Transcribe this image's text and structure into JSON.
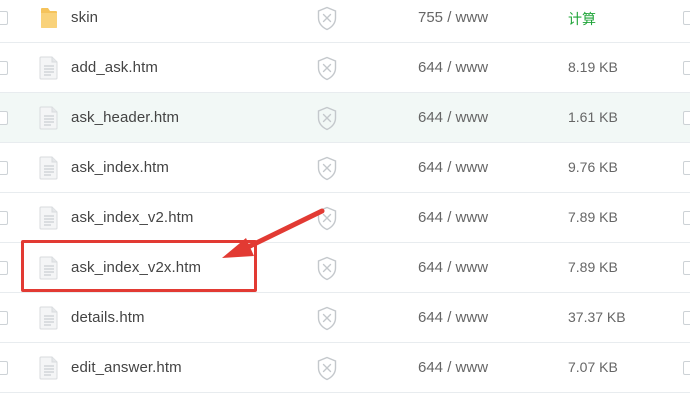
{
  "files": [
    {
      "name": "skin",
      "type": "folder",
      "perm": "755 / www",
      "size": "计算",
      "size_is_link": true
    },
    {
      "name": "add_ask.htm",
      "type": "file",
      "perm": "644 / www",
      "size": "8.19 KB",
      "size_is_link": false
    },
    {
      "name": "ask_header.htm",
      "type": "file",
      "perm": "644 / www",
      "size": "1.61 KB",
      "size_is_link": false
    },
    {
      "name": "ask_index.htm",
      "type": "file",
      "perm": "644 / www",
      "size": "9.76 KB",
      "size_is_link": false
    },
    {
      "name": "ask_index_v2.htm",
      "type": "file",
      "perm": "644 / www",
      "size": "7.89 KB",
      "size_is_link": false
    },
    {
      "name": "ask_index_v2x.htm",
      "type": "file",
      "perm": "644 / www",
      "size": "7.89 KB",
      "size_is_link": false
    },
    {
      "name": "details.htm",
      "type": "file",
      "perm": "644 / www",
      "size": "37.37 KB",
      "size_is_link": false
    },
    {
      "name": "edit_answer.htm",
      "type": "file",
      "perm": "644 / www",
      "size": "7.07 KB",
      "size_is_link": false
    }
  ],
  "hovered_row": 2,
  "highlighted_row": 5,
  "colors": {
    "accent_green": "#20a53a",
    "annotation_red": "#e23a33",
    "row_border": "#e8ecef",
    "hover_bg": "#f2f8f6"
  },
  "icons": {
    "folder": "folder-icon",
    "file": "file-icon",
    "protect": "shield-x-icon"
  }
}
